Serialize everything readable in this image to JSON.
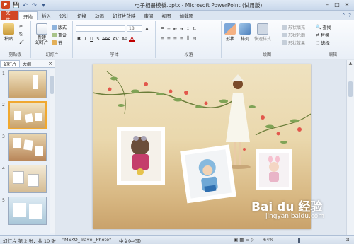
{
  "window": {
    "title": "电子相册模板.pptx - Microsoft PowerPoint (试用版)",
    "controls": [
      "–",
      "□",
      "✕"
    ]
  },
  "quick_access": {
    "logo": "P",
    "save": "💾",
    "undo": "↶",
    "redo": "↷",
    "customize": "▾"
  },
  "ribbon_tabs": [
    "文件",
    "开始",
    "插入",
    "设计",
    "切换",
    "动画",
    "幻灯片放映",
    "审阅",
    "视图",
    "加载项"
  ],
  "ribbon": {
    "clipboard": {
      "label": "剪贴板",
      "paste": "粘贴",
      "cut": "✂",
      "copy": "⎘",
      "brush": "🖌"
    },
    "slides": {
      "label": "幻灯片",
      "new_slide": "新建\n幻灯片",
      "layout": "版式",
      "reset": "重设",
      "section": "节"
    },
    "font": {
      "label": "字体",
      "font_size": "18",
      "bold": "B",
      "italic": "I",
      "underline": "U",
      "shadow": "S",
      "strike": "abc",
      "spacing": "AV",
      "case": "Aa",
      "color": "A"
    },
    "paragraph": {
      "label": "段落"
    },
    "drawing": {
      "label": "绘图",
      "shape": "形状",
      "arrange": "排列",
      "quick_style": "快速样式",
      "fill": "形状填充",
      "outline": "形状轮廓",
      "effect": "形状效果"
    },
    "editing": {
      "label": "编辑",
      "find": "查找",
      "replace": "替换",
      "select": "选择"
    }
  },
  "left_panel": {
    "tabs": [
      "幻灯片",
      "大纲"
    ],
    "close": "×",
    "slide_numbers": [
      "1",
      "2",
      "3",
      "4",
      "5"
    ]
  },
  "slide": {
    "watermark": "Bai du 经验",
    "watermark_url": "jingyan.baidu.com"
  },
  "status_bar": {
    "slide_info": "幻灯片 第 2 张，共 10 张",
    "theme": "\"MSKO_Travel_Photo\"",
    "language": "中文(中国)",
    "zoom": "64%"
  },
  "colors": {
    "accent_file": "#d24726",
    "selection": "#f0a830"
  }
}
